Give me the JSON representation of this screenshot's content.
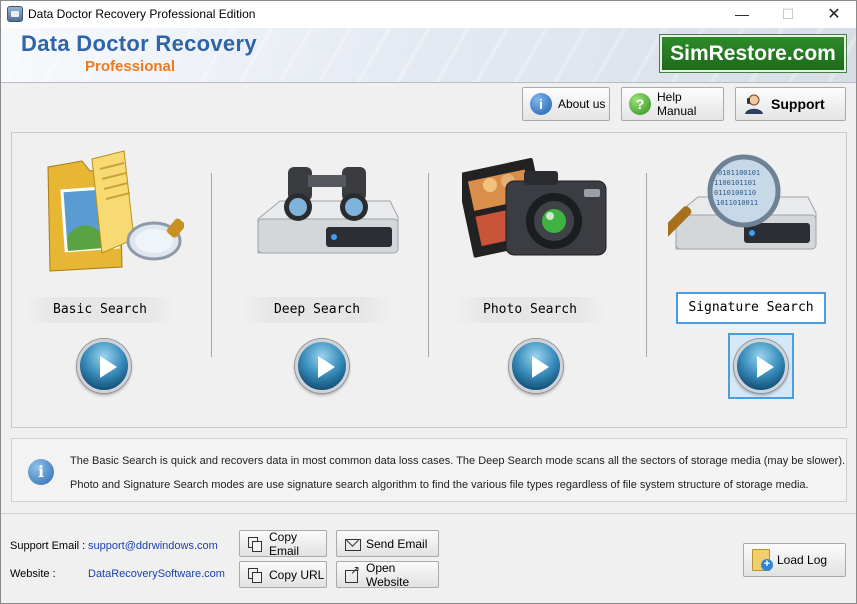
{
  "window": {
    "title": "Data Doctor Recovery Professional Edition",
    "controls": [
      "minimize",
      "maximize",
      "close"
    ]
  },
  "banner": {
    "product_name": "Data Doctor Recovery",
    "edition": "Professional",
    "brand": "SimRestore.com",
    "colors": {
      "product_name": "#2f64a6",
      "edition": "#ee7a1c",
      "brand_bg": "#24791f"
    }
  },
  "toolbar": {
    "about_label": "About us",
    "help_label": "Help Manual",
    "support_label": "Support"
  },
  "modes": [
    {
      "label": "Basic Search",
      "icon": "folder-magnifier-icon",
      "selected": false
    },
    {
      "label": "Deep Search",
      "icon": "binoculars-drive-icon",
      "selected": false
    },
    {
      "label": "Photo Search",
      "icon": "camera-filmstrip-icon",
      "selected": false
    },
    {
      "label": "Signature Search",
      "icon": "binary-magnifier-drive-icon",
      "selected": true
    }
  ],
  "info": {
    "line1": "The Basic Search is quick and recovers data in most common data loss cases. The Deep Search mode scans all the sectors of storage media (may be slower).",
    "line2": "Photo and Signature Search modes are use signature search algorithm to find the various file types regardless of file system structure of storage media."
  },
  "footer": {
    "support_email_label": "Support Email :",
    "support_email": "support@ddrwindows.com",
    "website_label": "Website :",
    "website": "DataRecoverySoftware.com",
    "copy_email_label": "Copy Email",
    "send_email_label": "Send Email",
    "copy_url_label": "Copy URL",
    "open_website_label": "Open Website",
    "load_log_label": "Load Log"
  }
}
